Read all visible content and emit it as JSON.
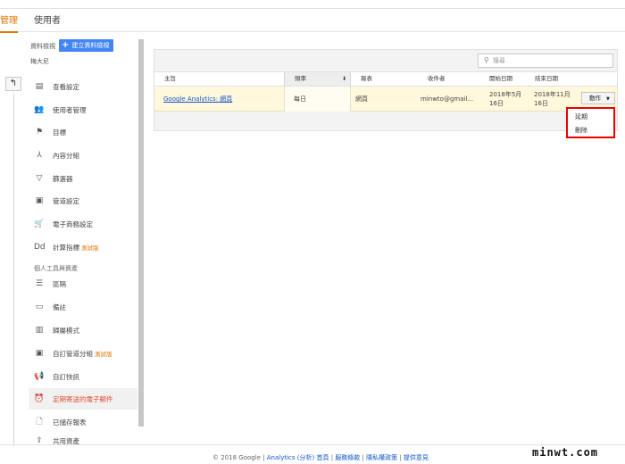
{
  "tabs": {
    "admin": "管理",
    "users": "使用者"
  },
  "account": {
    "view_label": "資料檢視",
    "create_view_button": "建立資料檢視",
    "view_name": "梅大尼"
  },
  "nav": {
    "items": [
      {
        "icon": "document-icon",
        "glyph": "▤",
        "label": "查看設定"
      },
      {
        "icon": "users-icon",
        "glyph": "👥",
        "label": "使用者管理"
      },
      {
        "icon": "flag-icon",
        "glyph": "⚑",
        "label": "目標"
      },
      {
        "icon": "content-group-icon",
        "glyph": "⅄",
        "label": "內容分組"
      },
      {
        "icon": "filter-icon",
        "glyph": "▽",
        "label": "篩選器"
      },
      {
        "icon": "channel-settings-icon",
        "glyph": "▣",
        "label": "管道設定"
      },
      {
        "icon": "cart-icon",
        "glyph": "🛒",
        "label": "電子商務設定"
      },
      {
        "icon": "calculated-metrics-icon",
        "glyph": "Dd",
        "label": "計算指標",
        "beta": "測試版"
      }
    ],
    "section_title": "個人工具與資產",
    "personal_items": [
      {
        "icon": "segments-icon",
        "glyph": "☰",
        "label": "區隔"
      },
      {
        "icon": "annotations-icon",
        "glyph": "▭",
        "label": "備註"
      },
      {
        "icon": "attribution-icon",
        "glyph": "▥",
        "label": "歸屬模式"
      },
      {
        "icon": "custom-channel-icon",
        "glyph": "▣",
        "label": "自訂管道分組",
        "beta": "測試版"
      },
      {
        "icon": "alerts-icon",
        "glyph": "📢",
        "label": "自訂快訊"
      },
      {
        "icon": "scheduled-email-icon",
        "glyph": "⏰",
        "label": "定期寄送的電子郵件"
      },
      {
        "icon": "saved-reports-icon",
        "glyph": "🗋",
        "label": "已儲存報表"
      },
      {
        "icon": "share-assets-icon",
        "glyph": "⇪",
        "label": "共用資產"
      }
    ]
  },
  "table": {
    "search_placeholder": "搜尋",
    "columns": [
      "主旨",
      "頻率",
      "報表",
      "收件者",
      "開始日期",
      "結束日期"
    ],
    "rows": [
      {
        "subject": "Google Analytics: 網頁",
        "frequency": "每日",
        "report": "網頁",
        "recipient": "minwto@gmail...",
        "start_date": "2018年5月16日",
        "end_date": "2018年11月16日",
        "action": "動作"
      }
    ]
  },
  "action_menu": {
    "items": [
      "延期",
      "刪除"
    ]
  },
  "footer": {
    "copyright": "© 2018 Google | ",
    "links": [
      "Analytics (分析) 首頁",
      "服務條款",
      "隱私權政策",
      "提供意見"
    ]
  },
  "watermark": "minwt.com"
}
